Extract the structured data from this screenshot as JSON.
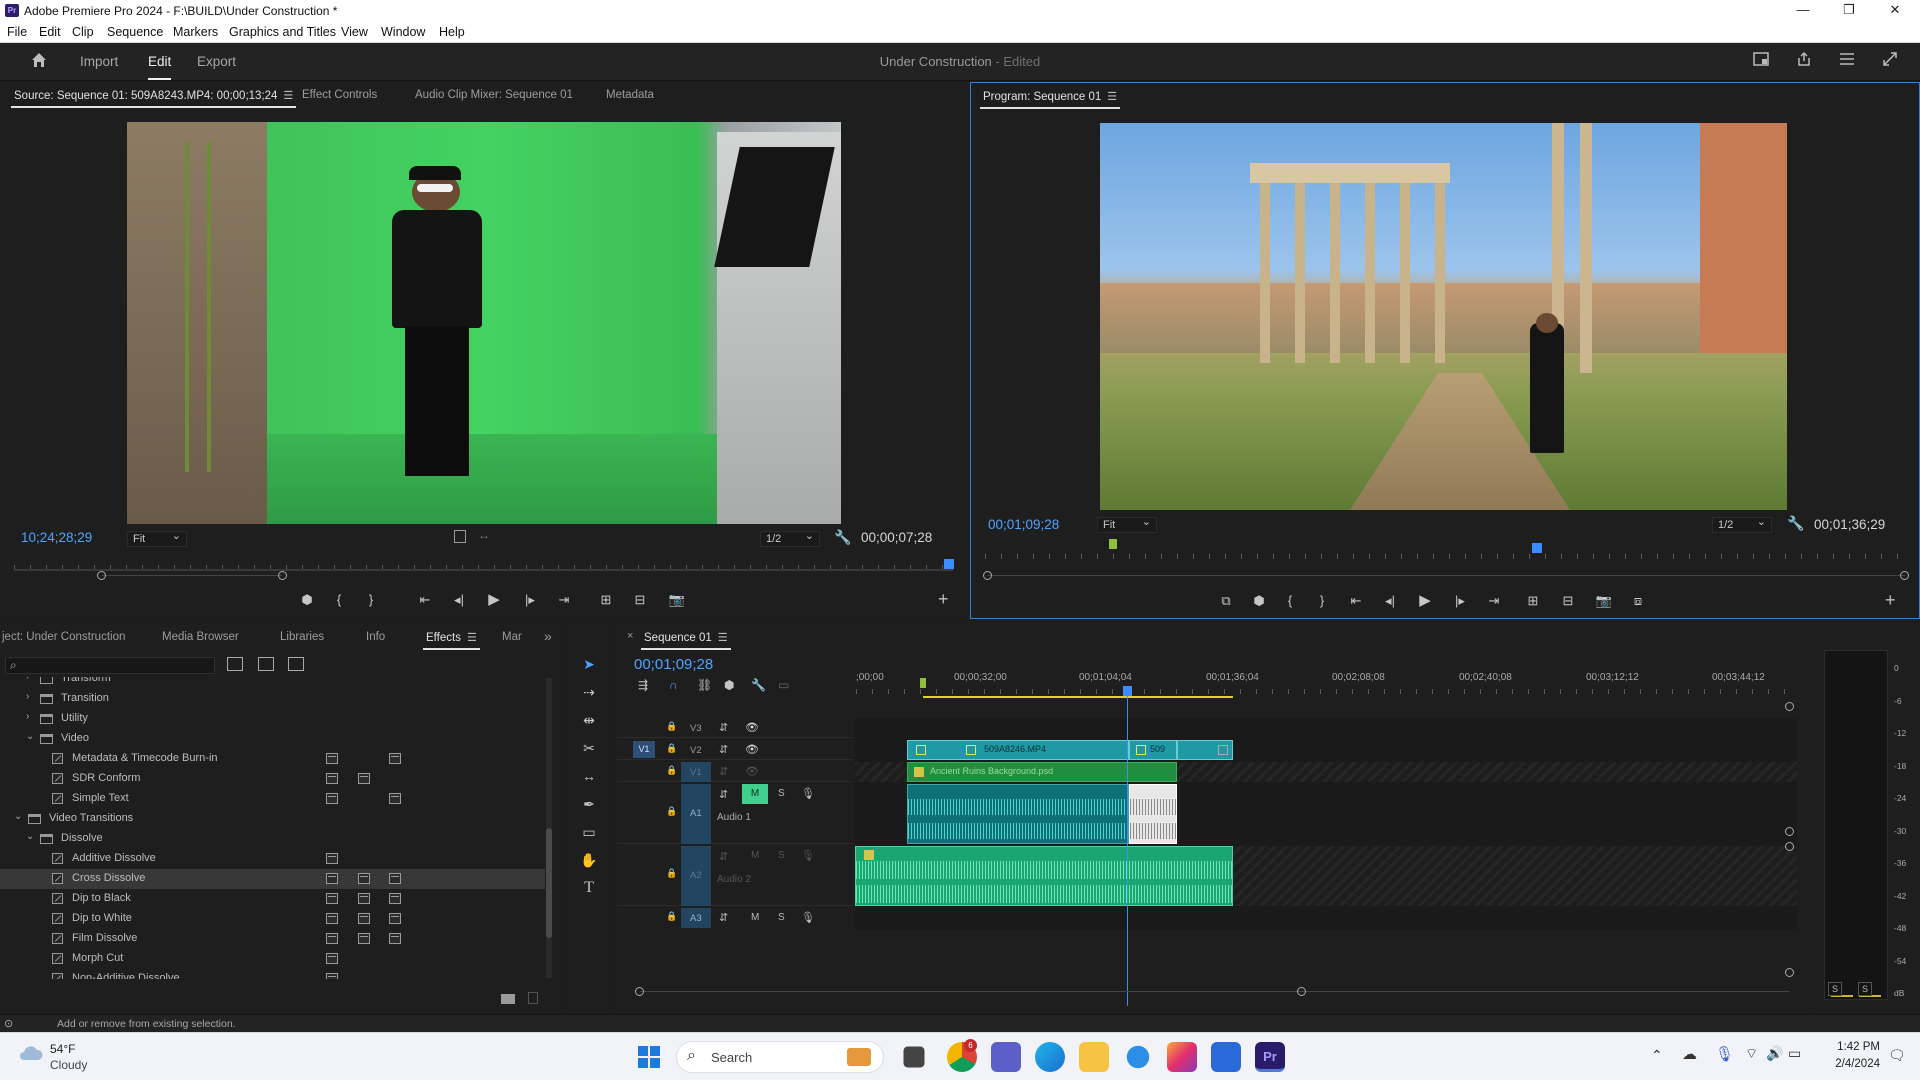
{
  "app": {
    "title": "Adobe Premiere Pro 2024 - F:\\BUILD\\Under Construction *",
    "icon_text": "Pr",
    "window_controls": [
      "—",
      "❐",
      "✕"
    ]
  },
  "menu": [
    "File",
    "Edit",
    "Clip",
    "Sequence",
    "Markers",
    "Graphics and Titles",
    "View",
    "Window",
    "Help"
  ],
  "workspace": {
    "tabs": [
      "Import",
      "Edit",
      "Export"
    ],
    "active_tab": "Edit",
    "project_name": "Under Construction",
    "project_status": "- Edited"
  },
  "source_monitor": {
    "tabs": [
      "Source: Sequence 01: 509A8243.MP4: 00;00;13;24",
      "Effect Controls",
      "Audio Clip Mixer: Sequence 01",
      "Metadata"
    ],
    "timecode_left": "10;24;28;29",
    "fit": "Fit",
    "resolution": "1/2",
    "timecode_right": "00;00;07;28"
  },
  "program_monitor": {
    "tab": "Program: Sequence 01",
    "timecode_left": "00;01;09;28",
    "fit": "Fit",
    "resolution": "1/2",
    "timecode_right": "00;01;36;29"
  },
  "effects_panel": {
    "tabs": [
      "ject: Under Construction",
      "Media Browser",
      "Libraries",
      "Info",
      "Effects",
      "Mar"
    ],
    "active_tab": "Effects",
    "search_placeholder": "",
    "items": [
      {
        "label": "Transform",
        "level": 1,
        "kind": "folder",
        "open": false
      },
      {
        "label": "Transition",
        "level": 1,
        "kind": "folder",
        "open": false
      },
      {
        "label": "Utility",
        "level": 1,
        "kind": "folder",
        "open": false
      },
      {
        "label": "Video",
        "level": 1,
        "kind": "folder",
        "open": true
      },
      {
        "label": "Metadata & Timecode Burn-in",
        "level": 2,
        "kind": "effect"
      },
      {
        "label": "SDR Conform",
        "level": 2,
        "kind": "effect"
      },
      {
        "label": "Simple Text",
        "level": 2,
        "kind": "effect"
      },
      {
        "label": "Video Transitions",
        "level": 0,
        "kind": "folder",
        "open": true
      },
      {
        "label": "Dissolve",
        "level": 1,
        "kind": "folder",
        "open": true
      },
      {
        "label": "Additive Dissolve",
        "level": 2,
        "kind": "effect"
      },
      {
        "label": "Cross Dissolve",
        "level": 2,
        "kind": "effect",
        "selected": true
      },
      {
        "label": "Dip to Black",
        "level": 2,
        "kind": "effect"
      },
      {
        "label": "Dip to White",
        "level": 2,
        "kind": "effect"
      },
      {
        "label": "Film Dissolve",
        "level": 2,
        "kind": "effect"
      },
      {
        "label": "Morph Cut",
        "level": 2,
        "kind": "effect"
      },
      {
        "label": "Non-Additive Dissolve",
        "level": 2,
        "kind": "effect"
      }
    ]
  },
  "timeline": {
    "tab": "Sequence 01",
    "timecode": "00;01;09;28",
    "ruler_labels": [
      ";00;00",
      "00;00;32;00",
      "00;01;04;04",
      "00;01;36;04",
      "00;02;08;08",
      "00;02;40;08",
      "00;03;12;12",
      "00;03;44;12"
    ],
    "tracks": {
      "v3": "V3",
      "v2": "V2",
      "v1": "V1",
      "v1_src": "V1",
      "a1": "A1",
      "a1_name": "Audio 1",
      "a2": "A2",
      "a2_name": "Audio 2",
      "a3": "A3",
      "m": "M",
      "s": "S"
    },
    "clips": {
      "v2_clip": "509A8246.MP4",
      "v2_clip2": "509",
      "v1_clip": "Ancient Ruins Background.psd"
    }
  },
  "meter": {
    "scale": [
      "0",
      "-6",
      "-12",
      "-18",
      "-24",
      "-30",
      "-36",
      "-42",
      "-48",
      "-54",
      "dB"
    ],
    "solo": [
      "S",
      "S"
    ]
  },
  "status_bar": "Add or remove from existing selection.",
  "taskbar": {
    "weather_temp": "54°F",
    "weather_desc": "Cloudy",
    "search": "Search",
    "time": "1:42 PM",
    "date": "2/4/2024",
    "chrome_badge": "6"
  }
}
